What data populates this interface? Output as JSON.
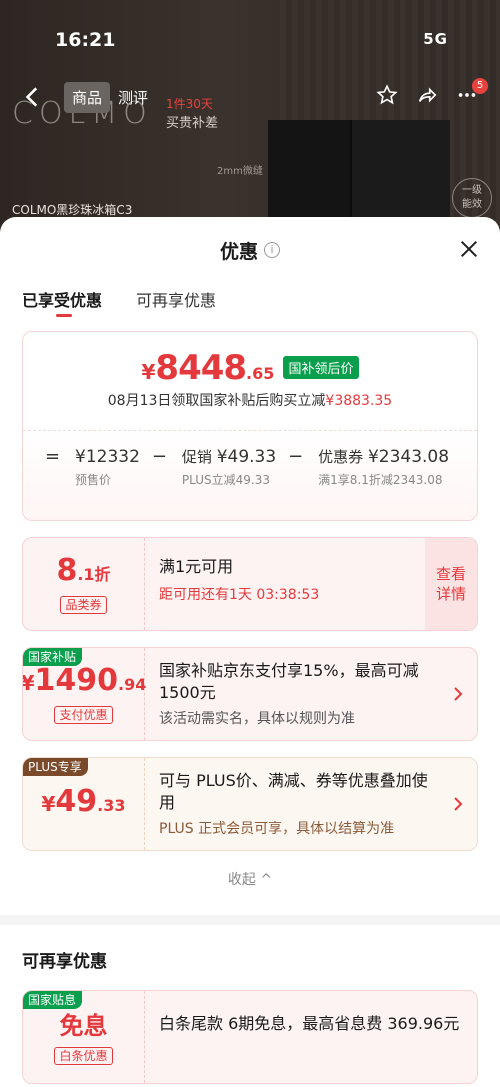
{
  "status": {
    "time": "16:21",
    "right": "5G"
  },
  "hero": {
    "logo": "COLMO",
    "tabs": [
      "商品",
      "测评"
    ],
    "promo_line1": "1件30天",
    "promo_line2": "买贵补差",
    "note": "2mm微缝",
    "caption": "COLMO黑珍珠冰箱C3",
    "circle_text": "一级\n能效",
    "cart_count": "5"
  },
  "sheet": {
    "title": "优惠",
    "tabs": [
      "已享受优惠",
      "可再享优惠"
    ],
    "price": {
      "yen": "¥",
      "integer": "8448",
      "decimal": ".65",
      "tag": "国补领后价",
      "desc_prefix": "08月13日领取国家补贴后购买立减",
      "desc_amount": "¥3883.35"
    },
    "formula": [
      {
        "op": "=",
        "label": "",
        "value": "¥12332",
        "sub": "预售价"
      },
      {
        "op": "−",
        "label": "促销 ",
        "value": "¥49.33",
        "sub": "PLUS立减49.33"
      },
      {
        "op": "−",
        "label": "优惠券 ",
        "value": "¥2343.08",
        "sub": "满1享8.1折减2343.08"
      }
    ],
    "coupons": [
      {
        "big": "8",
        "small": ".1折",
        "tag": "品类券",
        "title": "满1元可用",
        "sub": "距可用还有1天 03:38:53",
        "detail": "查看\n详情"
      },
      {
        "corner": "国家补贴",
        "yen": "¥",
        "big": "1490",
        "small": ".94",
        "tag": "支付优惠",
        "title": "国家补贴京东支付享15%，最高可减1500元",
        "sub": "该活动需实名，具体以规则为准"
      },
      {
        "corner": "PLUS专享",
        "yen": "¥",
        "big": "49",
        "small": ".33",
        "title": "可与 PLUS价、满减、券等优惠叠加使用",
        "sub": "PLUS 正式会员可享，具体以结算为准"
      }
    ],
    "collapse": "收起 ^",
    "more_title": "可再享优惠",
    "more_coupon": {
      "corner": "国家贴息",
      "big": "免息",
      "tag": "白条优惠",
      "title": "白条尾款 6期免息，最高省息费 369.96元"
    }
  }
}
